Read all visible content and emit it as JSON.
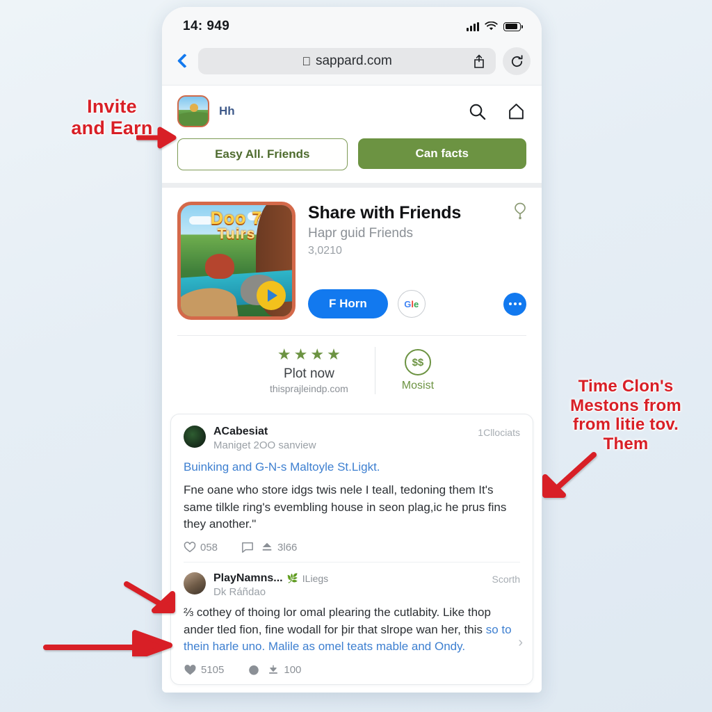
{
  "statusbar": {
    "time": "14: 949"
  },
  "browser": {
    "url": "sappard.com",
    "back_icon": "chevron-left-icon",
    "share_icon": "share-icon",
    "reload_icon": "reload-icon"
  },
  "app_header": {
    "app_name": "Hh",
    "search_icon": "search-icon",
    "share_icon": "share-icon",
    "cta_outline": "Easy All. Friends",
    "cta_solid": "Can facts"
  },
  "listing": {
    "thumb_title": "Doo 7",
    "thumb_subtitle": "Tuirs",
    "play_icon": "play-icon",
    "title": "Share with Friends",
    "subtitle": "Hapr guid Friends",
    "meta": "3,0210",
    "pin_icon": "balloon-pin-icon",
    "primary_button": "F Horn",
    "google_button": "Gle",
    "more_icon": "more-dots-icon"
  },
  "rating": {
    "stars": 4,
    "star_glyph": "★",
    "label": "Plot now",
    "url": "thisprajleindp.com",
    "badge_icon": "money-circle-icon",
    "badge_label": "Mosist"
  },
  "comments": [
    {
      "avatar": "dark-logo-avatar",
      "name": "ACabesiat",
      "tag": "",
      "handle": "Maniget 2OO sanview",
      "right_meta": "1Cllociats",
      "link": "Buinking and G-N-s Maltoyle St.Ligkt.",
      "body": "Fne oane who store idgs twis nele I teall, tedoning them It's same tilkle ring's evembling house in seon plag,ic he prus fins they another.\"",
      "stats": {
        "like_icon": "heart-outline-icon",
        "likes": "058",
        "comment_icon": "comment-icon",
        "share_icon": "upload-icon",
        "shares": "3l66"
      }
    },
    {
      "avatar": "photo-avatar",
      "name": "PlayNamns...",
      "tag": "ILiegs",
      "handle": "Dk Ráñdao",
      "right_meta": "Scorth",
      "link": "",
      "body_part1": "⅔ cothey of thoing lor omal plearing the cutlabity. Like thop ander tled fion, fine wodall for þir that slrope wan her, this",
      "body_part2": "so to thein harle uno. Malile as omel teats mable and Ondy.",
      "stats": {
        "like_icon": "heart-filled-icon",
        "likes": "5105",
        "comment_icon": "comment-icon",
        "share_icon": "download-icon",
        "shares": "100"
      },
      "chevron": "chevron-right-icon"
    }
  ],
  "annotations": {
    "invite": "Invite\nand Earn",
    "invite_line1": "Invite",
    "invite_line2": "and Earn",
    "right_line1": "Time Clon's",
    "right_line2": "Mestons from",
    "right_line3": "from litie tov.",
    "right_line4": "Them",
    "arrow_color": "#d81f26"
  }
}
